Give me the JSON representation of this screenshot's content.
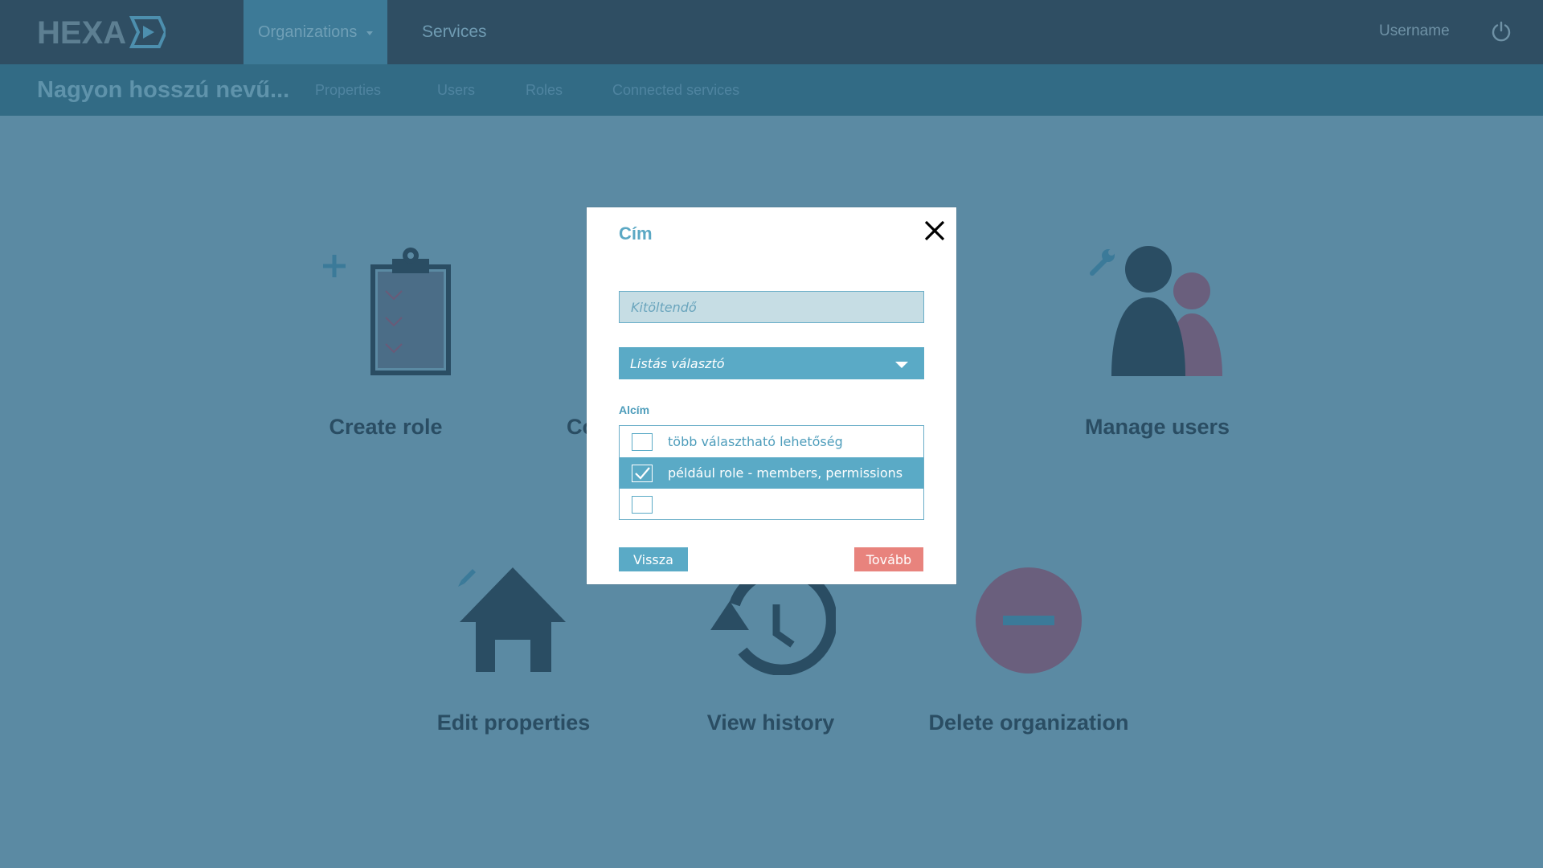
{
  "app": {
    "logo_text": "HEXA",
    "nav": {
      "organizations_label": "Organizations",
      "services_label": "Services"
    },
    "username": "Username",
    "icons": {
      "power": "power-icon",
      "caret": "caret-down-icon"
    }
  },
  "subnav": {
    "org_title": "Nagyon hosszú nevű...",
    "tabs": [
      "Properties",
      "Users",
      "Roles",
      "Connected services"
    ]
  },
  "actions": [
    {
      "label": "Create role",
      "icon": "clipboard-add-icon"
    },
    {
      "label": "Co",
      "icon": ""
    },
    {
      "label": "Manage users",
      "icon": "users-wrench-icon"
    },
    {
      "label": "Edit properties",
      "icon": "home-edit-icon"
    },
    {
      "label": "View history",
      "icon": "history-icon"
    },
    {
      "label": "Delete organization",
      "icon": "minus-circle-icon"
    }
  ],
  "modal": {
    "title": "Cím",
    "input_placeholder": "Kitöltendő",
    "select_value": "Listás választó",
    "subtitle": "Alcím",
    "checklist": [
      {
        "label": "több választható lehetőség",
        "checked": false
      },
      {
        "label": "például role - members, permissions",
        "checked": true
      },
      {
        "label": "",
        "checked": false
      }
    ],
    "back_label": "Vissza",
    "next_label": "Tovább"
  },
  "colors": {
    "topbar": "#2f4e63",
    "subbar": "#326b85",
    "background": "#5b8aa3",
    "accent": "#5aaac6",
    "next_button": "#e8837d"
  }
}
